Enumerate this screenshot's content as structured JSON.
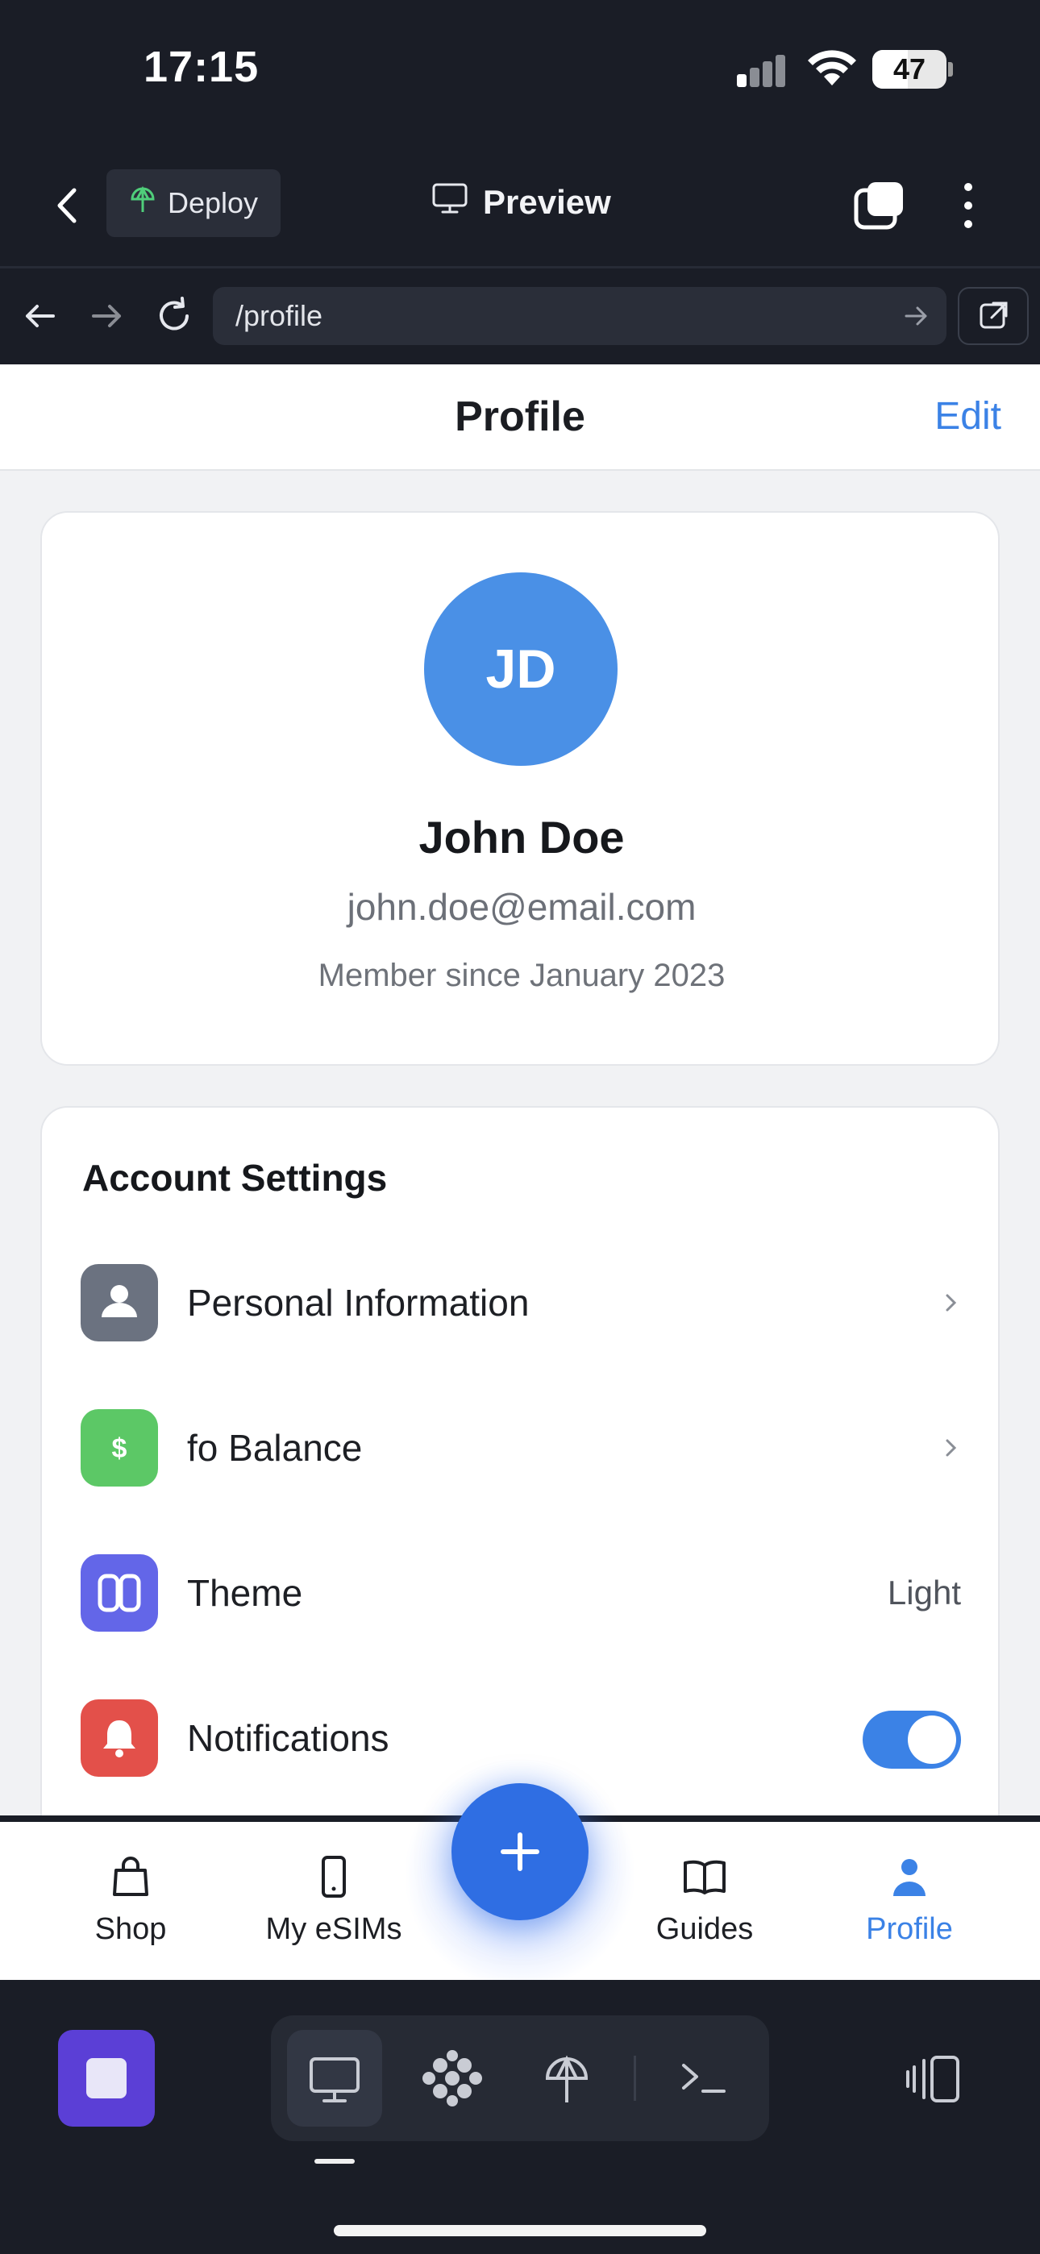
{
  "status_bar": {
    "time": "17:15",
    "battery": "47"
  },
  "toolbar": {
    "deploy_label": "Deploy",
    "preview_label": "Preview"
  },
  "url_bar": {
    "url": "/profile"
  },
  "page": {
    "title": "Profile",
    "edit_label": "Edit"
  },
  "profile": {
    "initials": "JD",
    "name": "John Doe",
    "email": "john.doe@email.com",
    "member_since": "Member since January 2023"
  },
  "settings": {
    "title": "Account Settings",
    "items": [
      {
        "label": "Personal Information",
        "icon": "person-icon",
        "icon_color": "#6b7280",
        "trailing": "chevron"
      },
      {
        "label": "fo Balance",
        "icon": "dollar-icon",
        "icon_color": "#5cc866",
        "trailing": "chevron"
      },
      {
        "label": "Theme",
        "icon": "theme-icon",
        "icon_color": "#6366e8",
        "trailing": "value",
        "value": "Light"
      },
      {
        "label": "Notifications",
        "icon": "bell-icon",
        "icon_color": "#e3504a",
        "trailing": "toggle",
        "enabled": true
      }
    ]
  },
  "tabbar": {
    "tabs": [
      {
        "label": "Shop",
        "icon": "shopping-bag-icon",
        "active": false
      },
      {
        "label": "My eSIMs",
        "icon": "phone-icon",
        "active": false
      },
      {
        "label": "Guides",
        "icon": "book-icon",
        "active": false
      },
      {
        "label": "Profile",
        "icon": "person-icon",
        "active": true
      }
    ],
    "fab_icon": "plus-icon"
  },
  "colors": {
    "accent": "#3b82e6",
    "dark_bg": "#1a1d26"
  }
}
